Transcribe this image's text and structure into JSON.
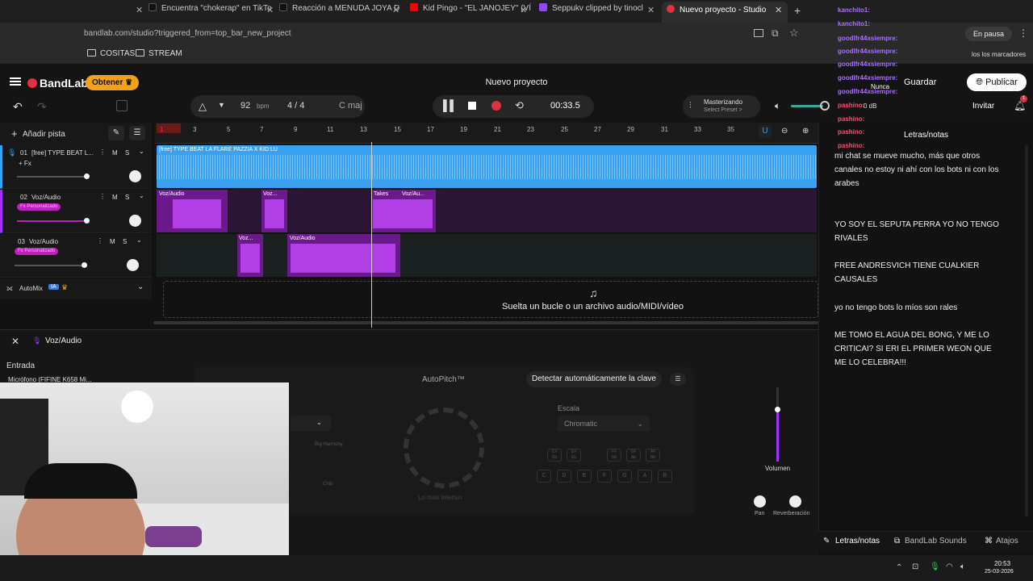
{
  "browser": {
    "tabs": [
      {
        "label": "Encuentra \"chokerap\" en TikTok",
        "color": "#111111"
      },
      {
        "label": "Reacción a MENUDA JOYA DYS",
        "color": "#111111"
      },
      {
        "label": "Kid Pingo - \"EL JANOJEY\" (VÍDE",
        "color": "#ff0000"
      },
      {
        "label": "Seppukv clipped by tinocl",
        "color": "#9146ff"
      },
      {
        "label": "Nuevo proyecto - Studio",
        "color": "#e0323c"
      }
    ],
    "url": "bandlab.com/studio?triggered_from=top_bar_new_project",
    "bookmarks": [
      "COSITAS",
      "STREAM"
    ],
    "bookmarks_right": "los los marcadores",
    "pause_label": "En pausa"
  },
  "app": {
    "logo": "BandLab",
    "get_label": "Obtener",
    "project_title": "Nuevo proyecto",
    "save_label": "Guardar",
    "publish_label": "Publicar",
    "invite_label": "Invitar",
    "notif_count": "1",
    "brand_color": "#e0323c",
    "accent_color": "#9b30ff",
    "audio_blue": "#3aa0f0"
  },
  "transport": {
    "bpm": "92",
    "bpm_unit": "bpm",
    "time_sig": "4 / 4",
    "key": "C maj",
    "time": "00:33.5",
    "mastering": "Masterizando",
    "select_preset": "Select Preset >",
    "db": "0 dB"
  },
  "timeline": {
    "add_track": "Añadir pista",
    "ticks": [
      "1",
      "3",
      "5",
      "7",
      "9",
      "11",
      "13",
      "15",
      "17",
      "19",
      "21",
      "23",
      "25",
      "27",
      "29",
      "31",
      "33",
      "35"
    ],
    "drop_text": "Suelta un bucle o un archivo audio/MIDI/vídeo"
  },
  "tracks": [
    {
      "num": "01",
      "name": "[free] TYPE BEAT L...",
      "sub": "+ Fx",
      "clip": "[free] TYPE BEAT LA FLARE PAZZIA X KID LU"
    },
    {
      "num": "02",
      "name": "Voz/Audio",
      "sub": "Fx Personalizado",
      "clips": [
        "Voz/Audio",
        "Voz...",
        "Takes",
        "Voz/Au..."
      ]
    },
    {
      "num": "03",
      "name": "Voz/Audio",
      "sub": "Fx Personalizado",
      "clips": [
        "Voz...",
        "Voz/Audio"
      ]
    }
  ],
  "automix": {
    "label": "AutoMix",
    "badge": "IA"
  },
  "track_buttons": {
    "mute": "M",
    "solo": "S"
  },
  "editor": {
    "title": "Voz/Audio",
    "input_label": "Entrada",
    "input_value": "Micrófono (FIFINE K658 Mi...",
    "autopitch": "AutoPitch™",
    "detect_key": "Detectar automáticamente la clave",
    "scale_label": "Escala",
    "scale_value": "Chromatic",
    "notes": [
      "C",
      "D",
      "E",
      "F",
      "G",
      "A",
      "B"
    ],
    "sharps": [
      "C#\nDb",
      "D#\nEb",
      "F#\nGb",
      "G#\nAb",
      "A#\nBb"
    ],
    "knob_label": "Lo más intenso",
    "big_harmony": "Big Harmony",
    "chip": "Chip",
    "volume": "Volumen",
    "pan": "Pan",
    "reverb": "Reverberación"
  },
  "lyrics": {
    "title": "Letras/notas",
    "lines": [
      "mi chat se mueve mucho, más que otros canales no estoy ni ahí con los bots ni con los arabes",
      "YO SOY EL SEPUTA PERRA YO NO TENGO RIVALES",
      "FREE ANDRESVICH TIENE CUALKIER CAUSALES",
      "yo no tengo bots lo míos son rales",
      "ME TOMO EL AGUA DEL BONG, Y ME LO CRITICAI? SI ERI EL PRIMER WEON QUE ME LO CELEBRA!!!"
    ]
  },
  "chat_overlay": {
    "users": [
      "kanchito1:",
      "kanchito1:",
      "goodlfr44xsiempre:",
      "goodlfr44xsiempre:",
      "goodlfr44xsiempre:",
      "goodlfr44xsiempre:",
      "goodlfr44xsiempre:",
      "goodlfr44xsiempre:",
      "pashino:",
      "pashino:",
      "pashino:",
      "pashino:"
    ],
    "nunca": "Nunca"
  },
  "bottom_tabs": {
    "lyrics": "Letras/notas",
    "sounds": "BandLab Sounds",
    "shortcuts": "Atajos"
  },
  "taskbar": {
    "time": "20:53",
    "date": "25-03-2026"
  }
}
